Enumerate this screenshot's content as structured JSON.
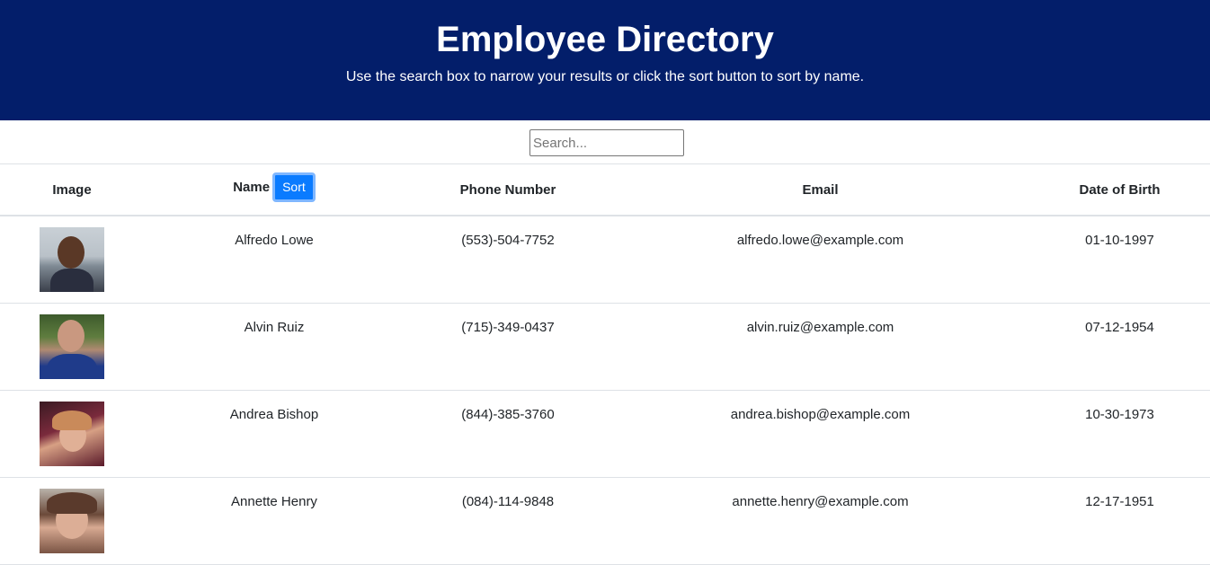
{
  "header": {
    "title": "Employee Directory",
    "subtitle": "Use the search box to narrow your results or click the sort button to sort by name."
  },
  "search": {
    "placeholder": "Search...",
    "value": ""
  },
  "table": {
    "headers": {
      "image": "Image",
      "name": "Name",
      "sort_label": "Sort",
      "phone": "Phone Number",
      "email": "Email",
      "dob": "Date of Birth"
    },
    "rows": [
      {
        "name": "Alfredo Lowe",
        "phone": "(553)-504-7752",
        "email": "alfredo.lowe@example.com",
        "dob": "01-10-1997",
        "photo": "avatar-photo"
      },
      {
        "name": "Alvin Ruiz",
        "phone": "(715)-349-0437",
        "email": "alvin.ruiz@example.com",
        "dob": "07-12-1954",
        "photo": "avatar-photo"
      },
      {
        "name": "Andrea Bishop",
        "phone": "(844)-385-3760",
        "email": "andrea.bishop@example.com",
        "dob": "10-30-1973",
        "photo": "avatar-photo"
      },
      {
        "name": "Annette Henry",
        "phone": "(084)-114-9848",
        "email": "annette.henry@example.com",
        "dob": "12-17-1951",
        "photo": "avatar-photo"
      }
    ]
  },
  "colors": {
    "header_bg": "#031e6a",
    "sort_button_bg": "#0a7bff"
  }
}
